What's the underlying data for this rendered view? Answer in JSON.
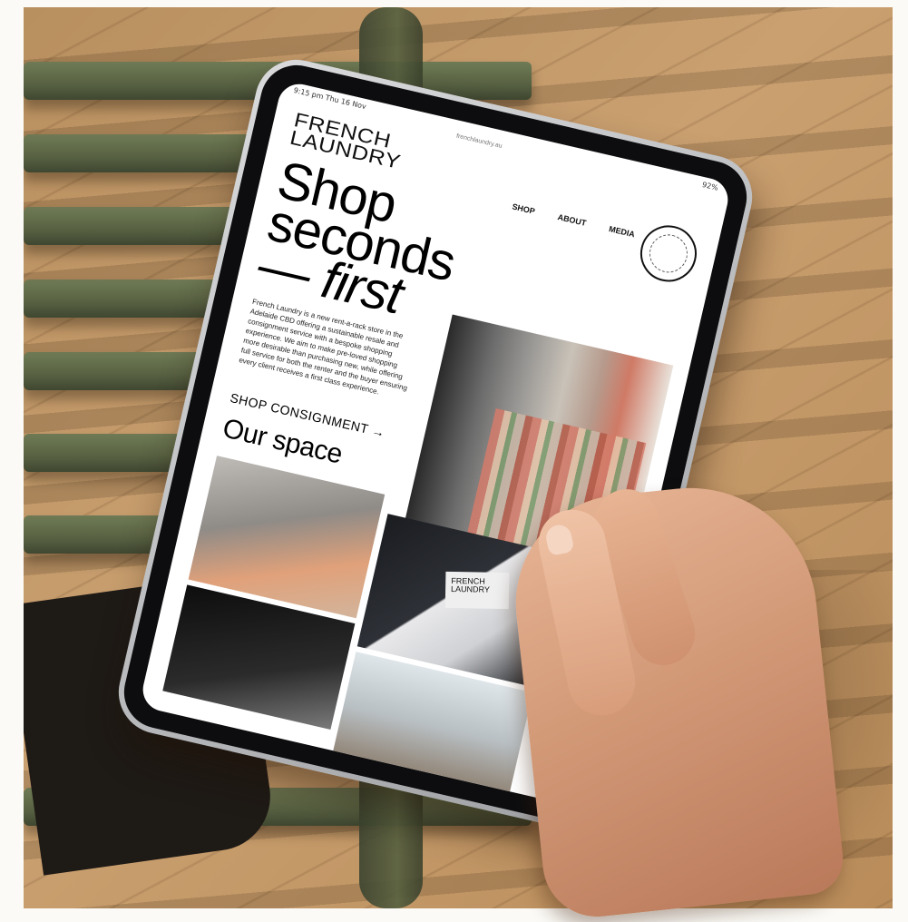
{
  "site": {
    "status_left": "9:15 pm  Thu 16 Nov",
    "status_right": "92%",
    "url": "frenchlaundry.au",
    "logo_line1": "FRENCH",
    "logo_line2": "LAUNDRY",
    "nav": [
      "SHOP",
      "ABOUT",
      "MEDIA"
    ],
    "hero_line1": "Shop",
    "hero_line2": "seconds",
    "hero_line3": "— first",
    "description": "French Laundry is a new rent-a-rack store in the Adelaide CBD offering a sustainable resale and consignment service with a bespoke shopping experience. We aim to make pre-loved shopping more desirable than purchasing new, while offering full service for both the renter and the buyer ensuring every client receives a first class experience.",
    "cta": "SHOP CONSIGNMENT →",
    "section_title": "Our space",
    "sign_text_line1": "FRENCH",
    "sign_text_line2": "LAUNDRY"
  },
  "colors": {
    "wood": "#caa070",
    "chair": "#5a6444",
    "tablet_frame": "#d9dadc",
    "bezel": "#0d0d0f",
    "screen": "#ffffff"
  }
}
